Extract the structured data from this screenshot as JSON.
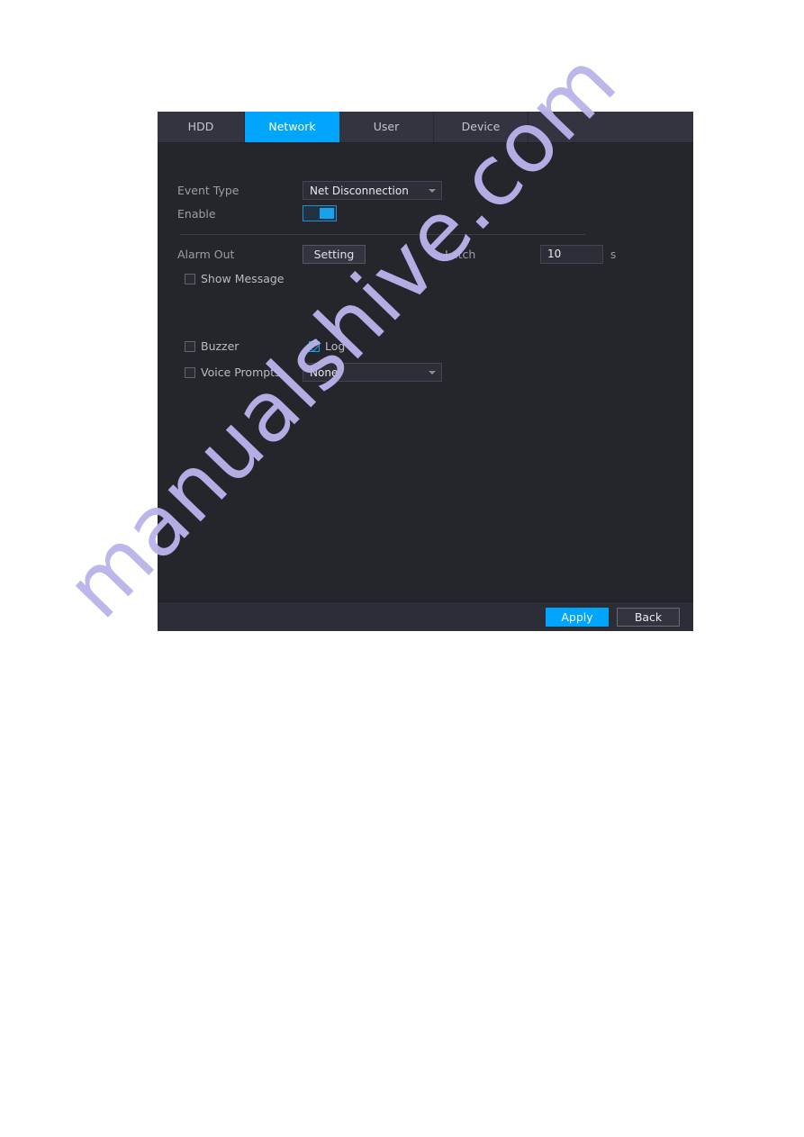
{
  "dialog": {
    "tabs": [
      {
        "label": "HDD",
        "active": false
      },
      {
        "label": "Network",
        "active": true
      },
      {
        "label": "User",
        "active": false
      },
      {
        "label": "Device",
        "active": false
      }
    ],
    "fields": {
      "event_type_label": "Event Type",
      "event_type_value": "Net Disconnection",
      "enable_label": "Enable",
      "enable_state": "on",
      "alarm_out_label": "Alarm Out",
      "alarm_out_button": "Setting",
      "latch_label": "Latch",
      "latch_value": "10",
      "latch_unit": "s",
      "show_message_label": "Show Message",
      "show_message_checked": false,
      "buzzer_label": "Buzzer",
      "buzzer_checked": false,
      "log_label": "Log",
      "log_checked": true,
      "voice_prompts_label": "Voice Prompts",
      "voice_prompts_checked": false,
      "voice_prompts_value": "None"
    },
    "footer": {
      "apply_label": "Apply",
      "back_label": "Back"
    }
  },
  "watermark": {
    "text": "manualshive.com"
  },
  "colors": {
    "accent_blue": "#00a6fb",
    "panel_bg": "#25262c",
    "tabbar_bg": "#32343f",
    "footer_bg": "#2b2d37",
    "label_text": "#9b9ea7",
    "value_text": "#e7e9ee"
  }
}
